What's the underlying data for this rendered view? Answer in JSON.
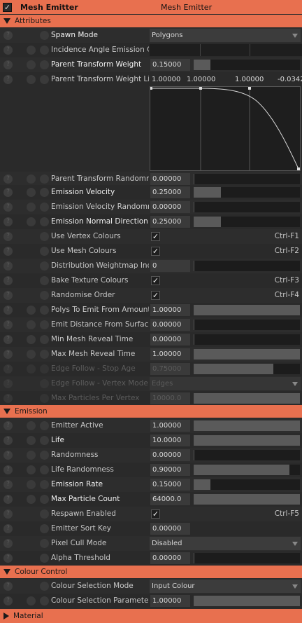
{
  "header": {
    "title_left": "Mesh Emitter",
    "title_center": "Mesh Emitter",
    "enabled_check": "✓"
  },
  "sections": {
    "attributes": "Attributes",
    "emission": "Emission",
    "colour_control": "Colour Control",
    "material": "Material"
  },
  "help_glyph": "?",
  "check_glyph": "✓",
  "attributes": {
    "spawn_mode": {
      "label": "Spawn Mode",
      "value": "Polygons"
    },
    "incidence": {
      "label": "Incidence Angle Emission Coe"
    },
    "parent_weight": {
      "label": "Parent Transform Weight",
      "value": "0.15000",
      "level": 0.15
    },
    "parent_weight_life": {
      "label": "Parent Transform Weight Life",
      "keys": [
        "1.00000",
        "1.00000",
        "1.00000",
        "-0.0342"
      ]
    },
    "parent_random": {
      "label": "Parent Transform Randomnes",
      "value": "0.00000",
      "level": 0.0
    },
    "emission_velocity": {
      "label": "Emission Velocity",
      "value": "0.25000",
      "level": 0.25
    },
    "emission_velocity_random": {
      "label": "Emission Velocity Randomnes",
      "value": "0.00000",
      "level": 0.0
    },
    "emission_normal": {
      "label": "Emission Normal Direction Ve",
      "value": "0.25000",
      "level": 0.25
    },
    "use_vertex_colours": {
      "label": "Use Vertex Colours",
      "shortcut": "Ctrl-F1"
    },
    "use_mesh_colours": {
      "label": "Use Mesh Colours",
      "shortcut": "Ctrl-F2"
    },
    "distribution_weightmap": {
      "label": "Distribution Weightmap Index",
      "value": "0",
      "level": 0.0
    },
    "bake_texture": {
      "label": "Bake Texture Colours",
      "shortcut": "Ctrl-F3"
    },
    "randomise_order": {
      "label": "Randomise Order",
      "shortcut": "Ctrl-F4"
    },
    "polys_to_emit": {
      "label": "Polys To Emit From Amount",
      "value": "1.00000",
      "level": 1.0
    },
    "emit_distance": {
      "label": "Emit Distance From Surface",
      "value": "0.00000",
      "level": 0.0
    },
    "min_reveal": {
      "label": "Min Mesh Reveal Time",
      "value": "0.00000",
      "level": 0.0
    },
    "max_reveal": {
      "label": "Max Mesh Reveal Time",
      "value": "1.00000",
      "level": 1.0
    },
    "edge_stop_age": {
      "label": "Edge Follow - Stop Age",
      "value": "0.75000",
      "level": 0.75
    },
    "edge_vertex_mode": {
      "label": "Edge Follow - Vertex Mode",
      "value": "Edges"
    },
    "max_particles_vertex": {
      "label": "Max Particles Per Vertex",
      "value": "10000.0",
      "level": 1.0
    }
  },
  "emission": {
    "emitter_active": {
      "label": "Emitter Active",
      "value": "1.00000",
      "level": 1.0
    },
    "life": {
      "label": "Life",
      "value": "10.0000",
      "level": 1.0
    },
    "randomness": {
      "label": "Randomness",
      "value": "0.00000",
      "level": 0.0
    },
    "life_randomness": {
      "label": "Life Randomness",
      "value": "0.90000",
      "level": 0.9
    },
    "emission_rate": {
      "label": "Emission Rate",
      "value": "0.15000",
      "level": 0.15
    },
    "max_particle_count": {
      "label": "Max Particle Count",
      "value": "64000.0",
      "level": 1.0
    },
    "respawn_enabled": {
      "label": "Respawn Enabled",
      "shortcut": "Ctrl-F5"
    },
    "emitter_sort_key": {
      "label": "Emitter Sort Key",
      "value": "0.00000"
    },
    "pixel_cull_mode": {
      "label": "Pixel Cull Mode",
      "value": "Disabled"
    },
    "alpha_threshold": {
      "label": "Alpha Threshold",
      "value": "0.00000",
      "level": 0.0
    }
  },
  "colour_control": {
    "selection_mode": {
      "label": "Colour Selection Mode",
      "value": "Input Colour"
    },
    "selection_param": {
      "label": "Colour Selection Parameter",
      "value": "1.00000",
      "level": 1.0
    }
  },
  "colors": {
    "accent": "#e8704f",
    "panel": "#2b2b2b",
    "field": "#3a3a3a",
    "slider_fill": "#5a5a5a"
  }
}
